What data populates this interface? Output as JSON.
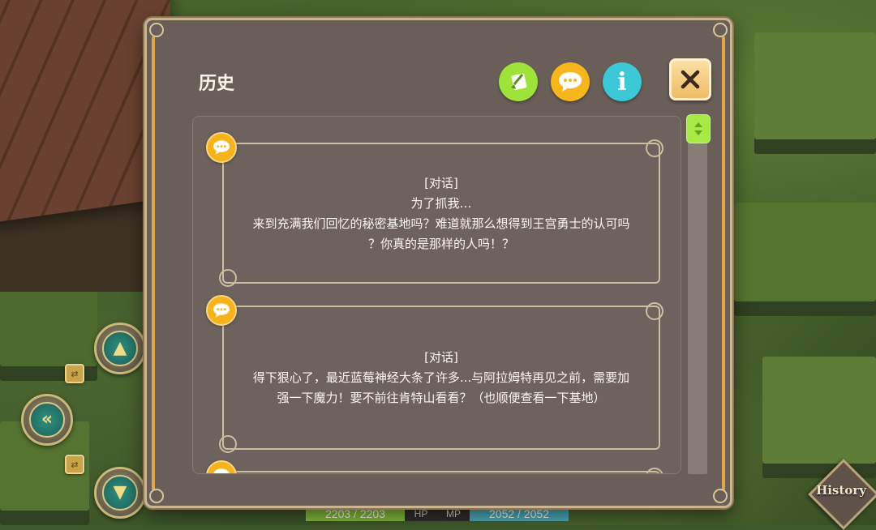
{
  "panel": {
    "title": "历史",
    "toolbar": {
      "note_icon": "note-icon",
      "chat_icon": "chat-icon",
      "info_label": "i",
      "close_icon": "close-icon"
    }
  },
  "entries": [
    {
      "icon": "chat-icon",
      "lines": [
        "[对话]",
        "为了抓我…",
        "来到充满我们回忆的秘密基地吗？难道就那么想得到王宫勇士的认可吗",
        "？你真的是那样的人吗！？"
      ]
    },
    {
      "icon": "chat-icon",
      "lines": [
        "[对话]",
        "得下狠心了，最近蓝莓神经大条了许多...与阿拉姆特再见之前，需要加",
        "强一下魔力！要不前往肯特山看看？（也顺便查看一下基地）"
      ]
    },
    {
      "icon": "chat-icon",
      "lines": []
    }
  ],
  "hud": {
    "hp_value": "2203 / 2203",
    "hp_label": "HP",
    "mp_label": "MP",
    "mp_value": "2052 / 2052",
    "history_button": "History"
  },
  "colors": {
    "panel_bg": "#6a5e59",
    "accent_green": "#9ee33a",
    "accent_yellow": "#f7b51e",
    "accent_cyan": "#3cc8d6",
    "hp_green": "#83b83a",
    "mp_blue": "#4ba8b9"
  }
}
